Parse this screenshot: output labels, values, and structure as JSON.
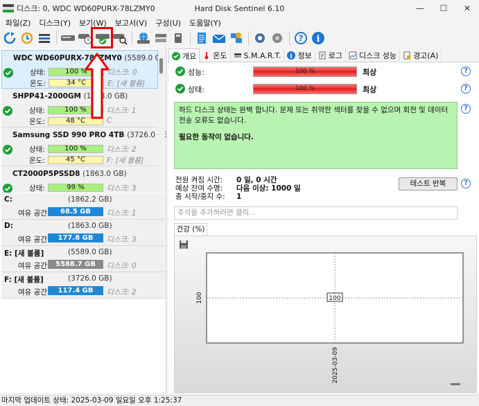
{
  "titlebar": {
    "left_title": "디스크: 0, WDC WD60PURX-78LZMY0",
    "center_title": "Hard Disk Sentinel 6.10",
    "buttons": [
      "—",
      "☐",
      "✕"
    ]
  },
  "menu": [
    "파일(Z)",
    "디스크(Y)",
    "보기(W)",
    "보고서(V)",
    "구성(U)",
    "도움말(Y)"
  ],
  "toolbar_icons": [
    "refresh-icon",
    "refresh-all-icon",
    "disk-list-icon",
    "disk-drive-icon",
    "disk-clock-icon",
    "disk-check-icon",
    "disk-search-icon",
    "globe-disk-icon",
    "drives-icon",
    "usb-drive-icon",
    "report-icon",
    "mail-icon",
    "network-icon",
    "settings-icon",
    "speaker-icon",
    "help-icon",
    "info-icon"
  ],
  "disks": [
    {
      "name": "WDC WD60PURX-78LZMY0",
      "size": "(5589.0 GB)",
      "health_label": "상태:",
      "health": "100 %",
      "temp_label": "온도:",
      "temp": "34 °C",
      "disk_tag": "디스크: 0",
      "vol_tag": "E: [새 볼륨]"
    },
    {
      "name": "SHPP41-2000GM",
      "size": "(1863.0 GB)",
      "health_label": "상태:",
      "health": "100 %",
      "temp_label": "온도:",
      "temp": "48 °C",
      "disk_tag": "디스크: 1",
      "vol_tag": "C"
    },
    {
      "name": "Samsung SSD 990 PRO 4TB",
      "size": "(3726.0 GB)",
      "health_label": "상태:",
      "health": "100 %",
      "temp_label": "온도:",
      "temp": "45 °C",
      "disk_tag": "디스크: 2",
      "vol_tag": "F: [새 볼륨]"
    },
    {
      "name": "CT2000P5PSSD8",
      "size": "(1863.0 GB)",
      "health_label": "상태:",
      "health": "99 %",
      "disk_tag": "디스크: 3"
    }
  ],
  "volumes": [
    {
      "name": "C:",
      "size": "(1862.2 GB)",
      "free_label": "여유 공간",
      "free": "68.5 GB",
      "disk": "디스크: 1",
      "gray": false
    },
    {
      "name": "D:",
      "size": "(1863.0 GB)",
      "free_label": "여유 공간",
      "free": "177.8 GB",
      "disk": "디스크: 3",
      "gray": false
    },
    {
      "name": "E: [새 볼륨]",
      "size": "(5589.0 GB)",
      "free_label": "여유 공간",
      "free": "5588.7 GB",
      "disk": "디스크: 0",
      "gray": true
    },
    {
      "name": "F: [새 볼륨]",
      "size": "(3726.0 GB)",
      "free_label": "여유 공간",
      "free": "117.4 GB",
      "disk": "디스크: 2",
      "gray": false
    }
  ],
  "tabs": [
    {
      "label": "개요",
      "icon": "check-icon"
    },
    {
      "label": "온도",
      "icon": "thermometer-icon"
    },
    {
      "label": "S.M.A.R.T.",
      "icon": "smart-icon"
    },
    {
      "label": "정보",
      "icon": "info-icon"
    },
    {
      "label": "로그",
      "icon": "document-icon"
    },
    {
      "label": "디스크 성능",
      "icon": "chart-icon"
    },
    {
      "label": "경고(A)",
      "icon": "alert-icon"
    }
  ],
  "overview": {
    "performance_label": "성능:",
    "performance_value": "100 %",
    "performance_text": "최상",
    "health_label": "상태:",
    "health_value": "100 %",
    "health_text": "최상",
    "status_line1": "하드 디스크 상태는 완벽 합니다. 문제 또는 취약한 섹터를 찾을 수 없으며 회전 및 데이터 전송 오류도 없습니다.",
    "status_line2": "필요한 동작이 없습니다.",
    "power_on_label": "전원 켜짐 시간:",
    "power_on_value": "0 일, 0 시간",
    "remaining_label": "예상 잔여 수명:",
    "remaining_value": "다음 이상: 1000 일",
    "start_stop_label": "총 시작/중지 수:",
    "start_stop_value": "1",
    "repeat_button": "테스트 반복",
    "comment_placeholder": "주석을 추가하려면 클릭..."
  },
  "chart_tab": "건강 (%)",
  "chart_data": {
    "type": "line",
    "x": [
      "2025-03-09"
    ],
    "values": [
      100
    ],
    "ylabel": "100",
    "xlabel": "2025-03-09",
    "data_label": "100"
  },
  "statusbar": "마지막 업데이트 상태: 2025-03-09 일요일 오후 1:25:37",
  "help_char": "?"
}
